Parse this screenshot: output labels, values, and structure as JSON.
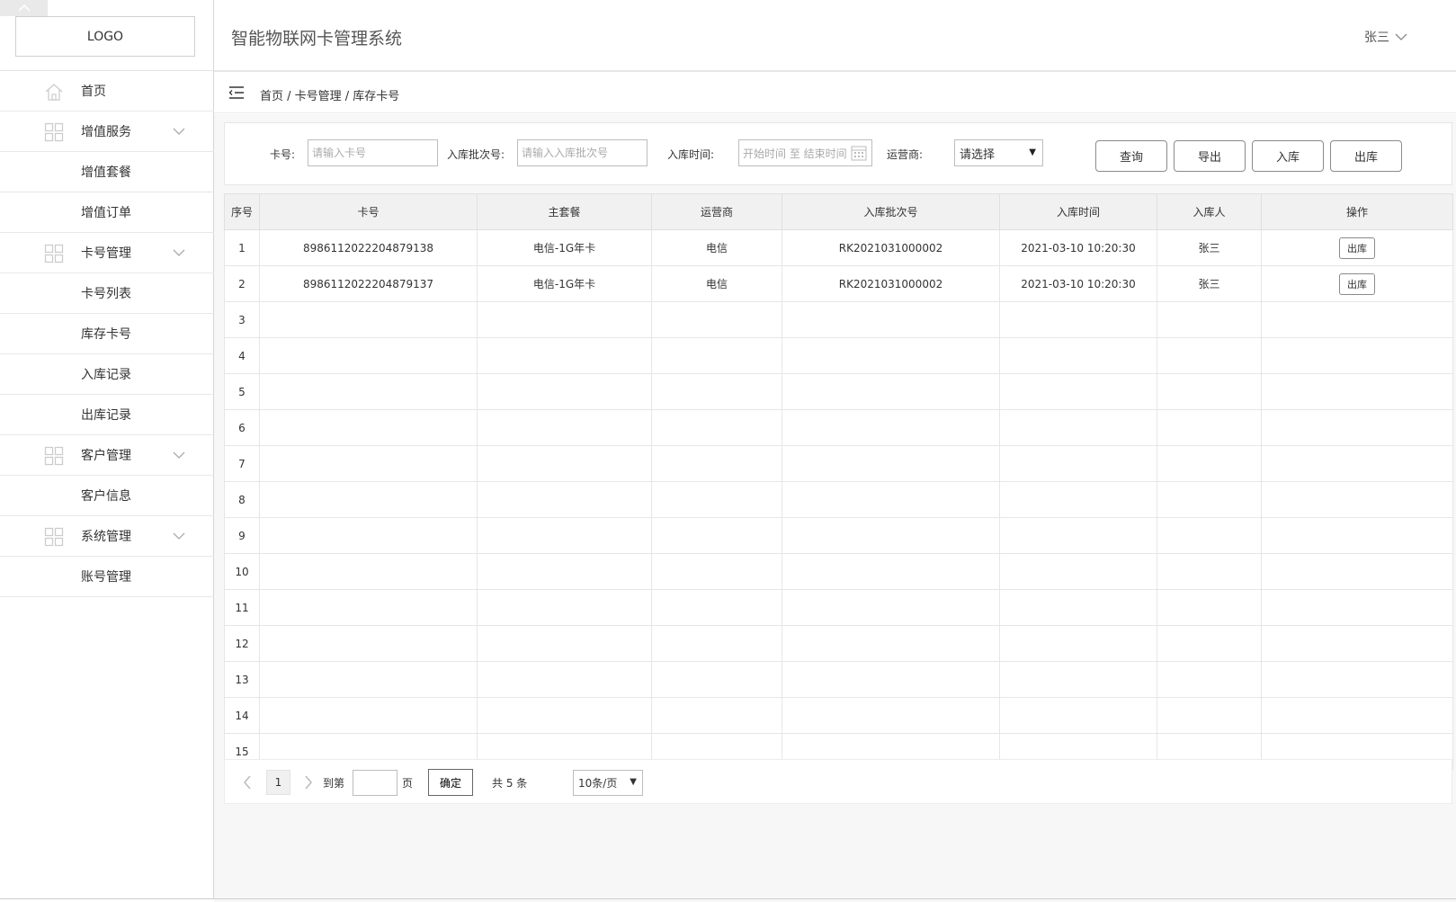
{
  "sidebar": {
    "logo": "LOGO",
    "items": [
      {
        "label": "首页",
        "type": "top",
        "icon": "home-icon"
      },
      {
        "label": "增值服务",
        "type": "group",
        "icon": "grid-icon"
      },
      {
        "label": "增值套餐",
        "type": "sub"
      },
      {
        "label": "增值订单",
        "type": "sub"
      },
      {
        "label": "卡号管理",
        "type": "group",
        "icon": "grid-icon"
      },
      {
        "label": "卡号列表",
        "type": "sub"
      },
      {
        "label": "库存卡号",
        "type": "sub"
      },
      {
        "label": "入库记录",
        "type": "sub"
      },
      {
        "label": "出库记录",
        "type": "sub"
      },
      {
        "label": "客户管理",
        "type": "group",
        "icon": "grid-icon"
      },
      {
        "label": "客户信息",
        "type": "sub"
      },
      {
        "label": "系统管理",
        "type": "group",
        "icon": "grid-icon"
      },
      {
        "label": "账号管理",
        "type": "sub"
      }
    ]
  },
  "header": {
    "title": "智能物联网卡管理系统",
    "user": "张三"
  },
  "breadcrumb": "首页 / 卡号管理 / 库存卡号",
  "filter": {
    "card_label": "卡号:",
    "card_placeholder": "请输入卡号",
    "batch_label": "入库批次号:",
    "batch_placeholder": "请输入入库批次号",
    "time_label": "入库时间:",
    "time_placeholder": "开始时间 至 结束时间",
    "carrier_label": "运营商:",
    "carrier_value": "请选择",
    "buttons": {
      "query": "查询",
      "export": "导出",
      "in": "入库",
      "out": "出库"
    }
  },
  "table": {
    "headers": [
      "序号",
      "卡号",
      "主套餐",
      "运营商",
      "入库批次号",
      "入库时间",
      "入库人",
      "操作"
    ],
    "rows": [
      {
        "idx": "1",
        "card": "8986112022204879138",
        "plan": "电信-1G年卡",
        "carrier": "电信",
        "batch": "RK2021031000002",
        "time": "2021-03-10 10:20:30",
        "user": "张三",
        "action": "出库"
      },
      {
        "idx": "2",
        "card": "8986112022204879137",
        "plan": "电信-1G年卡",
        "carrier": "电信",
        "batch": "RK2021031000002",
        "time": "2021-03-10 10:20:30",
        "user": "张三",
        "action": "出库"
      },
      {
        "idx": "3"
      },
      {
        "idx": "4"
      },
      {
        "idx": "5"
      },
      {
        "idx": "6"
      },
      {
        "idx": "7"
      },
      {
        "idx": "8"
      },
      {
        "idx": "9"
      },
      {
        "idx": "10"
      },
      {
        "idx": "11"
      },
      {
        "idx": "12"
      },
      {
        "idx": "13"
      },
      {
        "idx": "14"
      },
      {
        "idx": "15"
      }
    ]
  },
  "pager": {
    "current_page": "1",
    "goto_label": "到第",
    "page_unit": "页",
    "confirm": "确定",
    "total": "共 5 条",
    "page_size": "10条/页"
  }
}
